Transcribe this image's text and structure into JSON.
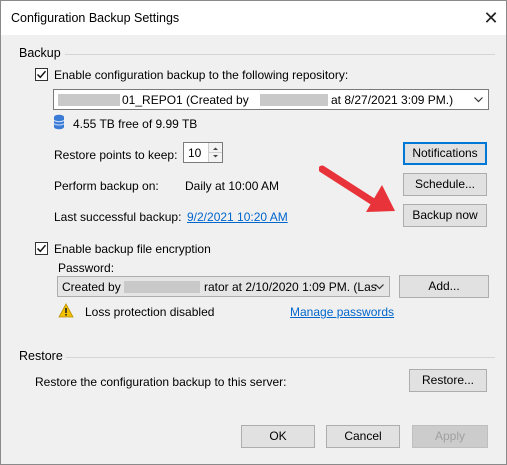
{
  "window": {
    "title": "Configuration Backup Settings",
    "close_glyph": "✕"
  },
  "backup": {
    "group_label": "Backup",
    "enable_checkbox": {
      "label": "Enable configuration backup to the following repository:",
      "checked": true
    },
    "repository": {
      "value_prefix": "01_REPO1 (Created by",
      "value_suffix": "at 8/27/2021 3:09 PM.)",
      "icon": "chevron-down-icon"
    },
    "storage": {
      "icon": "database-icon",
      "text": "4.55 TB free of 9.99 TB"
    },
    "restore_points": {
      "label": "Restore points to keep:",
      "value": "10"
    },
    "notifications_button": "Notifications",
    "perform_backup": {
      "label": "Perform backup on:",
      "value": "Daily at 10:00 AM"
    },
    "schedule_button": "Schedule...",
    "last_successful": {
      "label": "Last successful backup:",
      "value": "9/2/2021 10:20 AM"
    },
    "backup_now_button": "Backup now",
    "encryption_checkbox": {
      "label": "Enable backup file encryption",
      "checked": true
    },
    "password": {
      "label": "Password:",
      "value_prefix": "Created by",
      "value_suffix": "rator at 2/10/2020 1:09 PM. (Las",
      "add_button": "Add..."
    },
    "warning": {
      "icon": "warning-icon",
      "text": "Loss protection disabled",
      "color": "#f2c200"
    },
    "manage_passwords_link": "Manage passwords"
  },
  "restore": {
    "group_label": "Restore",
    "description": "Restore the configuration backup to this server:",
    "restore_button": "Restore..."
  },
  "footer": {
    "ok_button": "OK",
    "cancel_button": "Cancel",
    "apply_button": "Apply"
  },
  "annotation": {
    "type": "red-arrow",
    "color": "#e8333a"
  }
}
